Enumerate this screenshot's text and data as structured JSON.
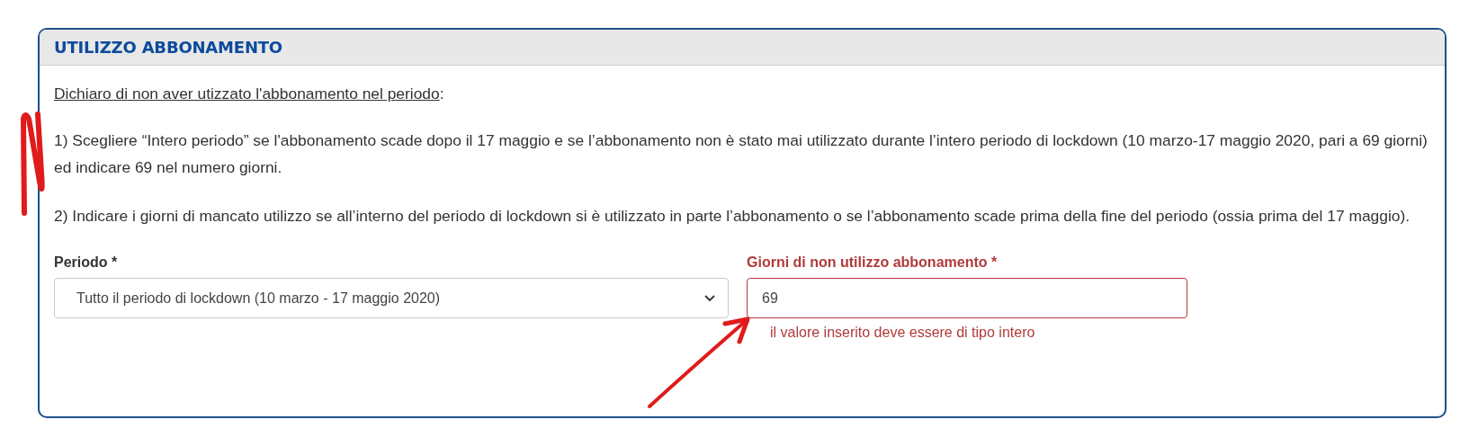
{
  "panel": {
    "title": "UTILIZZO ABBONAMENTO",
    "intro": "Dichiaro di non aver utizzato l'abbonamento nel periodo",
    "intro_suffix": ":",
    "paragraphs": [
      "1) Scegliere “Intero periodo” se l'abbonamento scade dopo il 17 maggio e se l’abbonamento non è stato mai utilizzato durante l’intero periodo di lockdown (10 marzo-17 maggio 2020, pari a 69 giorni) ed indicare 69 nel numero giorni.",
      "2) Indicare i giorni di mancato utilizzo se all’interno del periodo di lockdown si è utilizzato in parte l’abbonamento o se l’abbonamento scade prima della fine del periodo (ossia prima del 17 maggio)."
    ],
    "fields": [
      {
        "kind": "select",
        "label": "Periodo *",
        "value": "Tutto il periodo di lockdown (10 marzo - 17 maggio 2020)",
        "invalid": false
      },
      {
        "kind": "input",
        "label": "Giorni di non utilizzo abbonamento *",
        "value": "69",
        "invalid": true,
        "error": "il valore inserito deve essere di tipo intero"
      }
    ]
  }
}
